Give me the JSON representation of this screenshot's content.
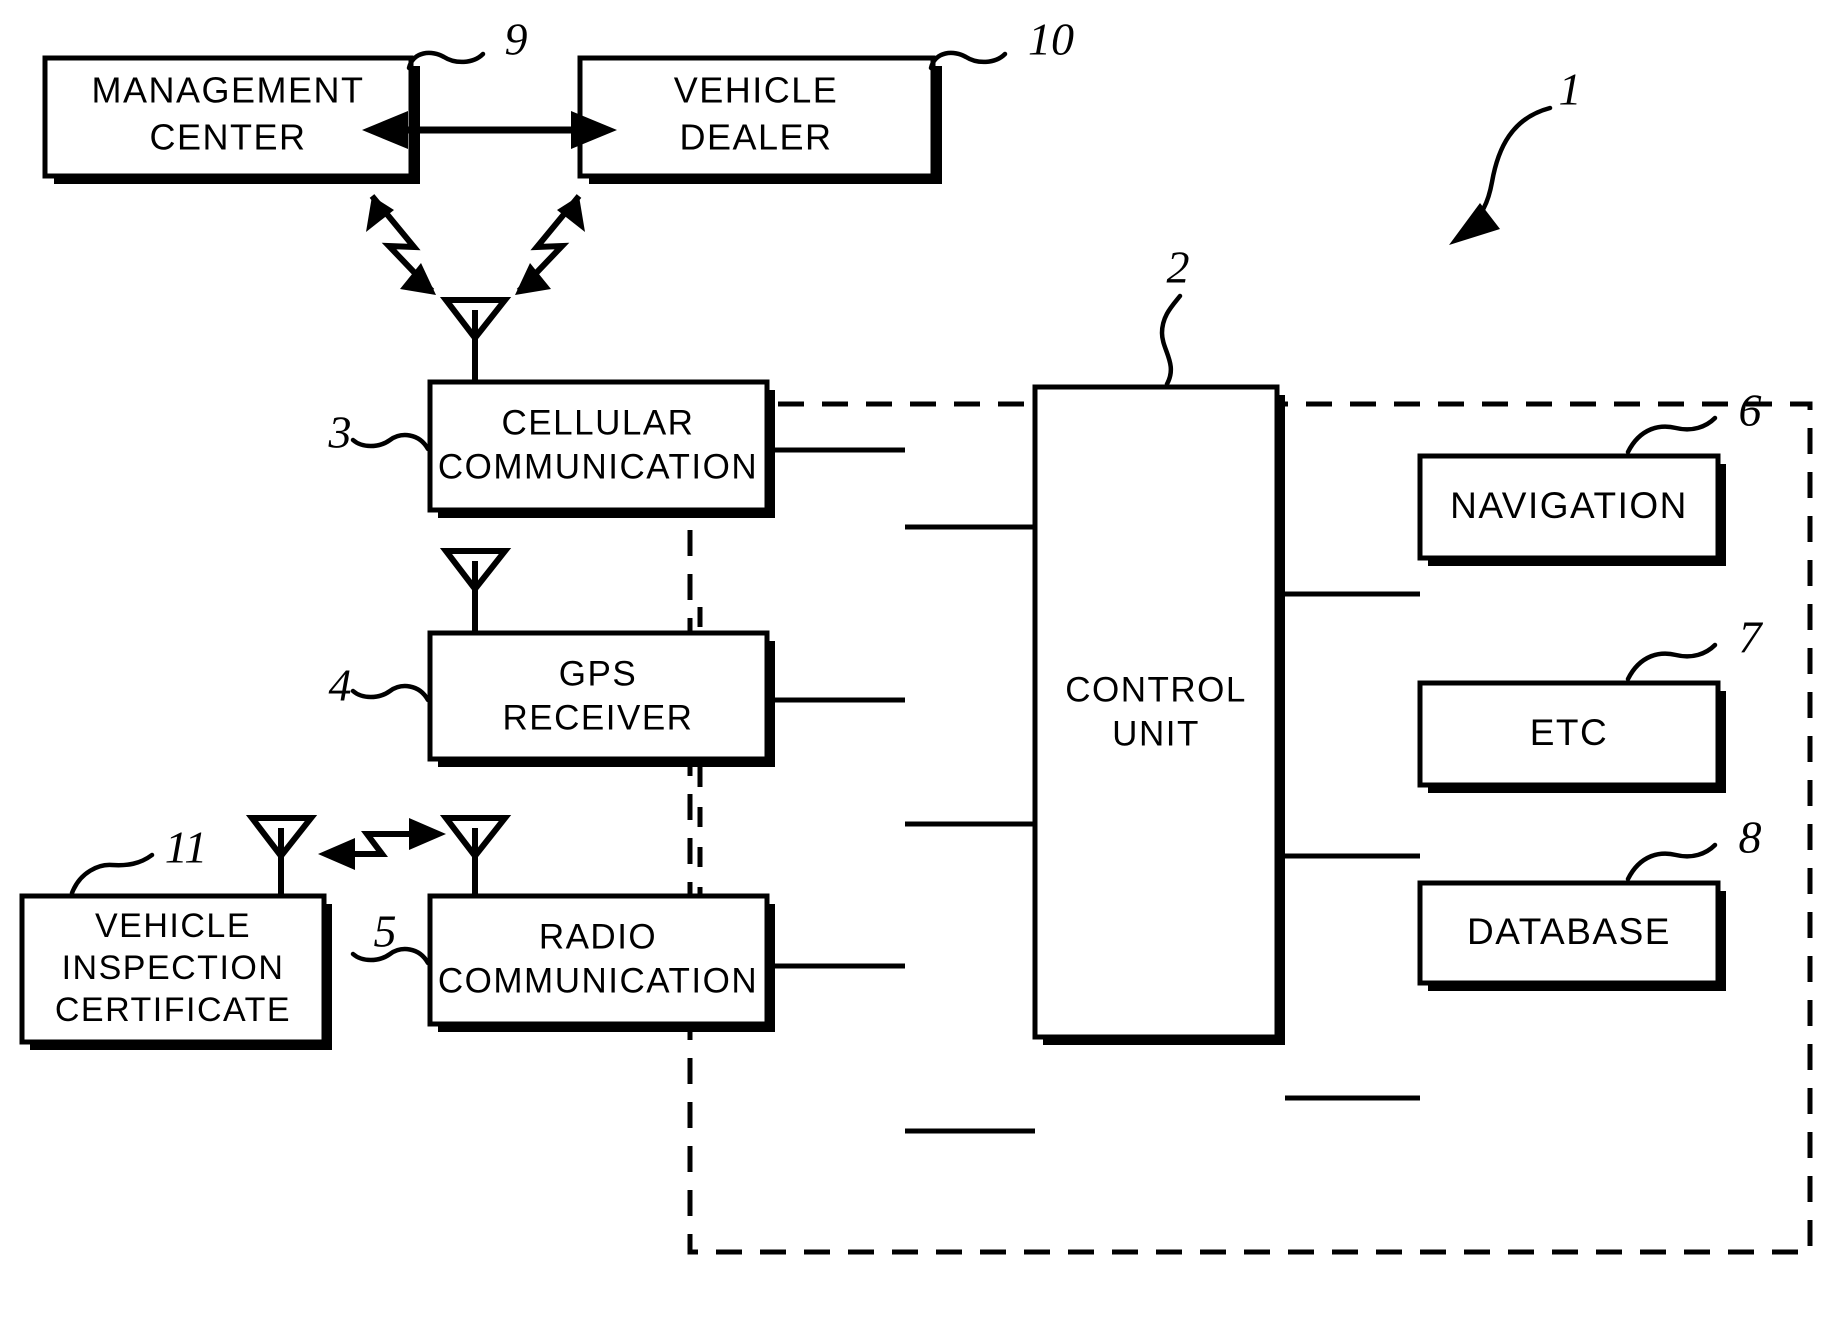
{
  "figure": {
    "type": "patent-block-diagram",
    "overall_ref": "1"
  },
  "boxes": {
    "management_center": {
      "line1": "MANAGEMENT",
      "line2": "CENTER",
      "ref": "9"
    },
    "vehicle_dealer": {
      "line1": "VEHICLE",
      "line2": "DEALER",
      "ref": "10"
    },
    "cellular": {
      "line1": "CELLULAR",
      "line2": "COMMUNICATION",
      "ref": "3"
    },
    "gps": {
      "line1": "GPS",
      "line2": "RECEIVER",
      "ref": "4"
    },
    "radio": {
      "line1": "RADIO",
      "line2": "COMMUNICATION",
      "ref": "5"
    },
    "control_unit": {
      "line1": "CONTROL",
      "line2": "UNIT",
      "ref": "2"
    },
    "navigation": {
      "line1": "NAVIGATION",
      "ref": "6"
    },
    "etc": {
      "line1": "ETC",
      "ref": "7"
    },
    "database": {
      "line1": "DATABASE",
      "ref": "8"
    },
    "certificate": {
      "line1": "VEHICLE",
      "line2": "INSPECTION",
      "line3": "CERTIFICATE",
      "ref": "11"
    }
  },
  "refs": {
    "r1": "1",
    "r2": "2",
    "r3": "3",
    "r4": "4",
    "r5": "5",
    "r6": "6",
    "r7": "7",
    "r8": "8",
    "r9": "9",
    "r10": "10",
    "r11": "11"
  },
  "colors": {
    "ink": "#000000",
    "paper": "#ffffff"
  }
}
